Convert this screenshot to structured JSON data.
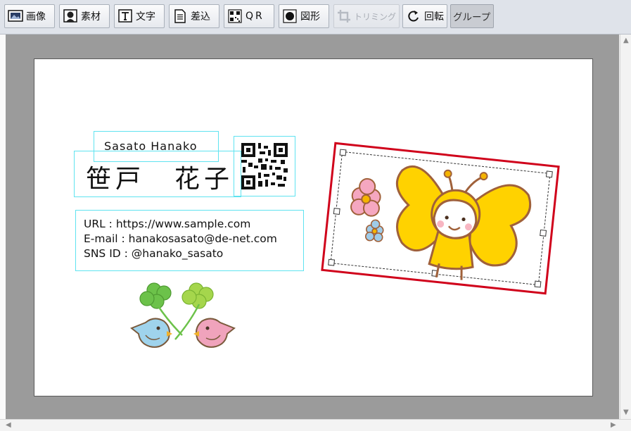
{
  "toolbar": {
    "buttons": [
      {
        "id": "image",
        "label": "画像",
        "icon": "image-icon"
      },
      {
        "id": "material",
        "label": "素材",
        "icon": "material-icon"
      },
      {
        "id": "text",
        "label": "文字",
        "icon": "text-icon"
      },
      {
        "id": "merge",
        "label": "差込",
        "icon": "document-icon"
      },
      {
        "id": "qr",
        "label": "QR",
        "icon": "qr-icon"
      },
      {
        "id": "shape",
        "label": "図形",
        "icon": "shape-icon"
      },
      {
        "id": "trim",
        "label": "トリミング",
        "icon": "crop-icon",
        "disabled": true
      },
      {
        "id": "rotate",
        "label": "回転",
        "icon": "rotate-icon"
      },
      {
        "id": "group",
        "label": "グループ",
        "pressed": true
      }
    ]
  },
  "card": {
    "name_romaji": "Sasato Hanako",
    "name_kanji": "笹戸　花子",
    "contact": {
      "url": "URL : https://www.sample.com",
      "email": "E-mail : hanakosasato@de-net.com",
      "sns": "SNS ID : @hanako_sasato"
    },
    "images": [
      "qr-code",
      "clover-birds-illustration",
      "butterfly-girl-illustration"
    ],
    "selection_color": "#d0021b",
    "guide_color": "#5fe3f0"
  }
}
